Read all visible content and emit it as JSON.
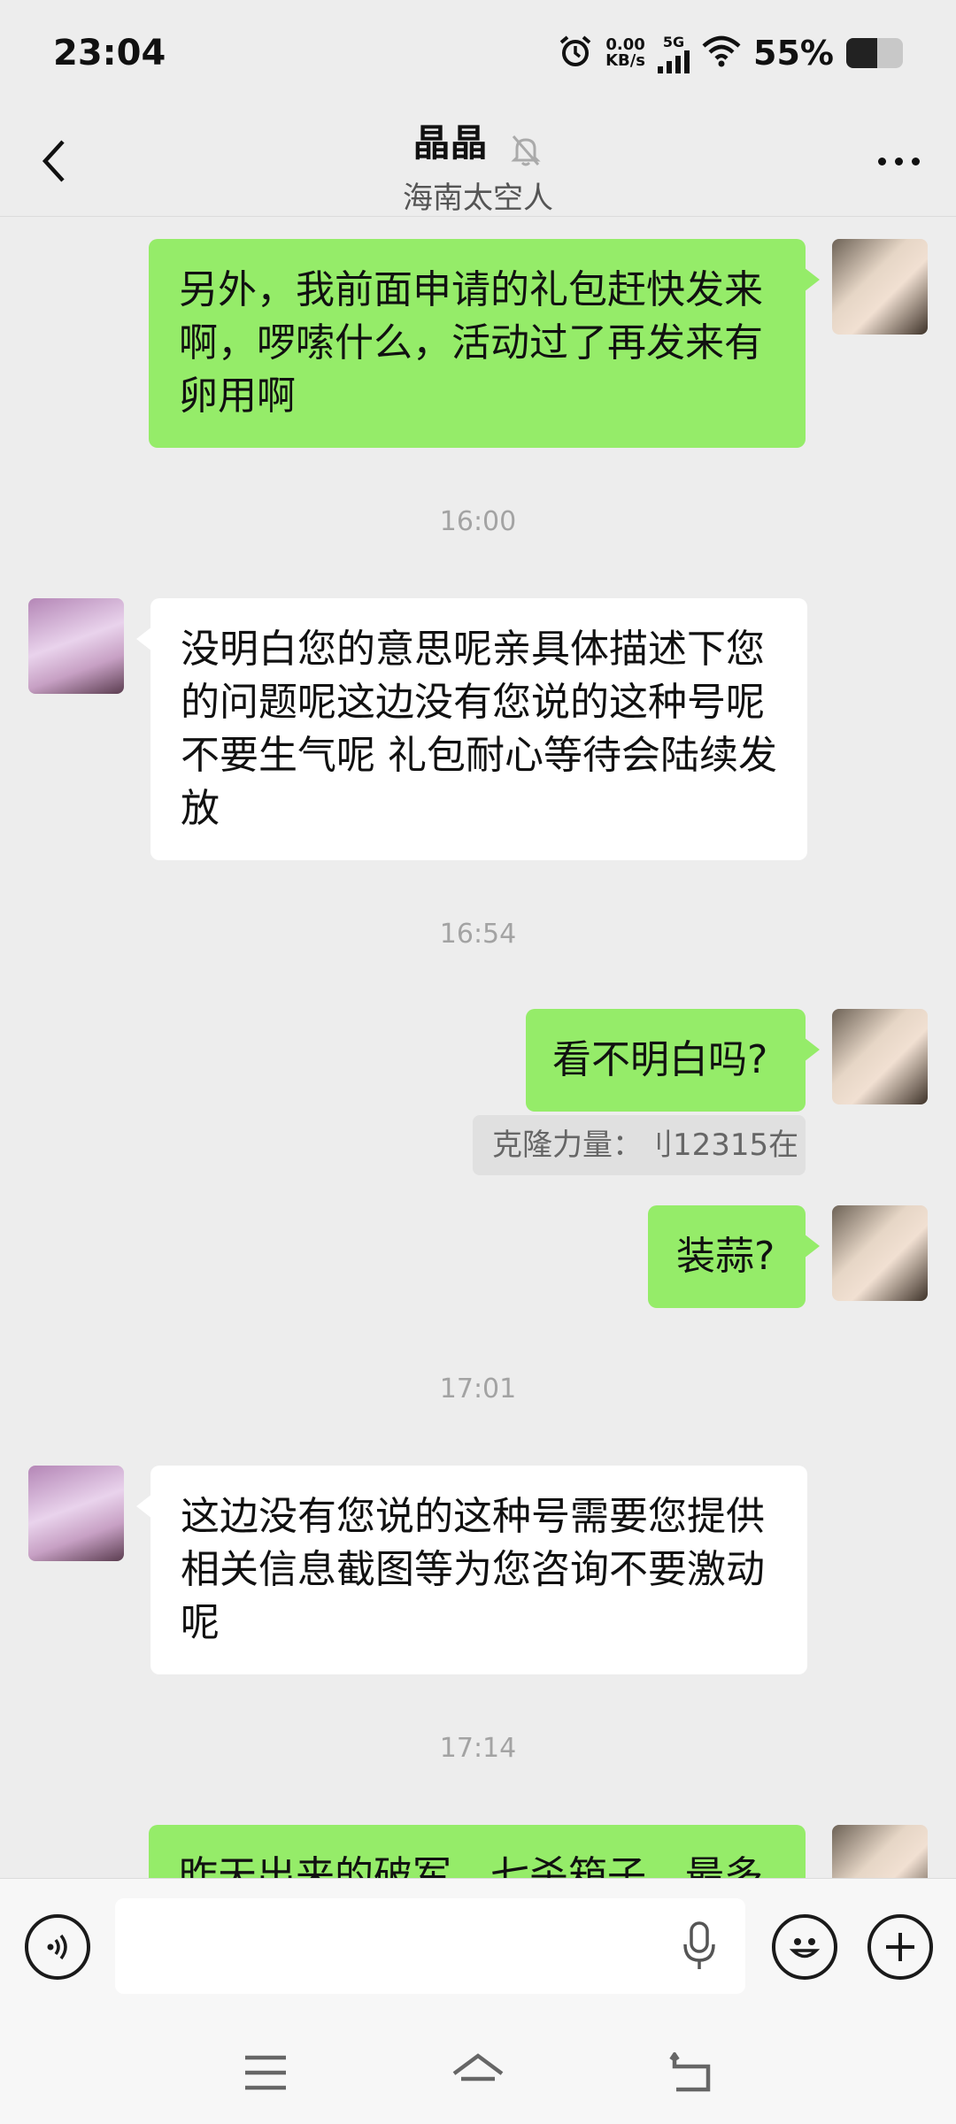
{
  "status_bar": {
    "time": "23:04",
    "net_speed_value": "0.00",
    "net_speed_unit": "KB/s",
    "network_type": "5G",
    "battery_percent": "55%",
    "battery_level": 0.55
  },
  "header": {
    "title": "晶晶",
    "subtitle": "海南太空人"
  },
  "messages": [
    {
      "side": "self",
      "text": "另外，我前面申请的礼包赶快发来啊，啰嗦什么，活动过了再发来有卵用啊"
    },
    {
      "side": "time",
      "text": "16:00"
    },
    {
      "side": "other",
      "text": "没明白您的意思呢亲具体描述下您的问题呢这边没有您说的这种号呢 不要生气呢 礼包耐心等待会陆续发放"
    },
    {
      "side": "time",
      "text": "16:54"
    },
    {
      "side": "self",
      "text": "看不明白吗?"
    },
    {
      "side": "quote",
      "text": "克隆力量：刂12315在"
    },
    {
      "side": "self",
      "text": "装蒜?"
    },
    {
      "side": "time",
      "text": "17:01"
    },
    {
      "side": "other",
      "text": "这边没有您说的这种号需要您提供相关信息截图等为您咨询不要激动呢"
    },
    {
      "side": "time",
      "text": "17:14"
    },
    {
      "side": "self",
      "text": "昨天出来的破军、七杀箱子，最多"
    }
  ],
  "colors": {
    "self_bubble": "#95ec69",
    "other_bubble": "#ffffff",
    "background": "#ededed"
  }
}
